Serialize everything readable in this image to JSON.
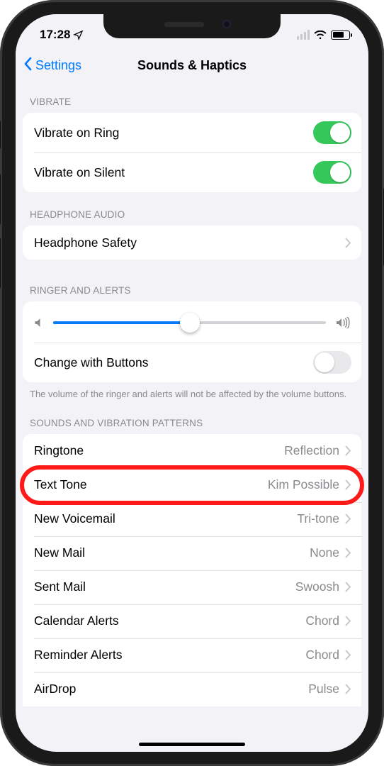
{
  "status": {
    "time": "17:28"
  },
  "nav": {
    "back_label": "Settings",
    "title": "Sounds & Haptics"
  },
  "sections": {
    "vibrate": {
      "header": "VIBRATE",
      "ring_label": "Vibrate on Ring",
      "ring_on": true,
      "silent_label": "Vibrate on Silent",
      "silent_on": true
    },
    "headphone": {
      "header": "HEADPHONE AUDIO",
      "safety_label": "Headphone Safety"
    },
    "ringer": {
      "header": "RINGER AND ALERTS",
      "slider_percent": 50,
      "change_label": "Change with Buttons",
      "change_on": false,
      "footer": "The volume of the ringer and alerts will not be affected by the volume buttons."
    },
    "sounds": {
      "header": "SOUNDS AND VIBRATION PATTERNS",
      "items": [
        {
          "label": "Ringtone",
          "value": "Reflection"
        },
        {
          "label": "Text Tone",
          "value": "Kim Possible"
        },
        {
          "label": "New Voicemail",
          "value": "Tri-tone"
        },
        {
          "label": "New Mail",
          "value": "None"
        },
        {
          "label": "Sent Mail",
          "value": "Swoosh"
        },
        {
          "label": "Calendar Alerts",
          "value": "Chord"
        },
        {
          "label": "Reminder Alerts",
          "value": "Chord"
        },
        {
          "label": "AirDrop",
          "value": "Pulse"
        }
      ]
    }
  },
  "annotation": {
    "highlighted_row_index": 1
  }
}
